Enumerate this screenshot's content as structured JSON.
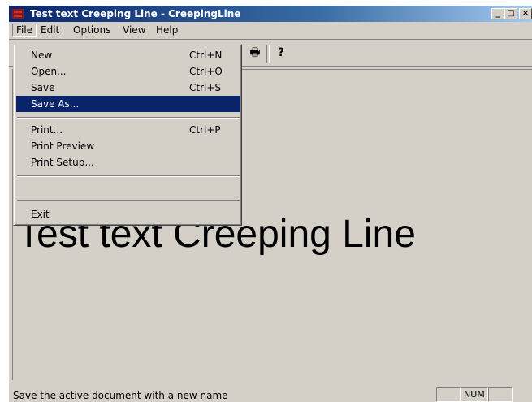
{
  "window": {
    "title": "Test text Creeping Line - CreepingLine"
  },
  "titlebar_buttons": {
    "minimize": "_",
    "maximize": "□",
    "close": "×"
  },
  "menubar": [
    {
      "label": "File"
    },
    {
      "label": "Edit"
    },
    {
      "label": "Options"
    },
    {
      "label": "View"
    },
    {
      "label": "Help"
    }
  ],
  "file_menu": {
    "items": [
      {
        "label": "New",
        "shortcut": "Ctrl+N"
      },
      {
        "label": "Open...",
        "shortcut": "Ctrl+O"
      },
      {
        "label": "Save",
        "shortcut": "Ctrl+S"
      },
      {
        "label": "Save As...",
        "shortcut": ""
      },
      {
        "label": "Print...",
        "shortcut": "Ctrl+P"
      },
      {
        "label": "Print Preview",
        "shortcut": ""
      },
      {
        "label": "Print Setup...",
        "shortcut": ""
      },
      {
        "label": "Exit",
        "shortcut": ""
      }
    ],
    "highlighted": "Save As..."
  },
  "toolbar": {
    "icons": [
      "print-icon",
      "help-icon"
    ],
    "glyphs": {
      "print": "🖶",
      "help": "?"
    }
  },
  "content": {
    "text": "Test text Creeping Line"
  },
  "statusbar": {
    "message": "Save the active document with a new name",
    "num": "NUM"
  },
  "colors": {
    "title_start": "#0a246a",
    "title_end": "#a6caf0",
    "face": "#d4d0c8",
    "highlight": "#0a246a"
  }
}
